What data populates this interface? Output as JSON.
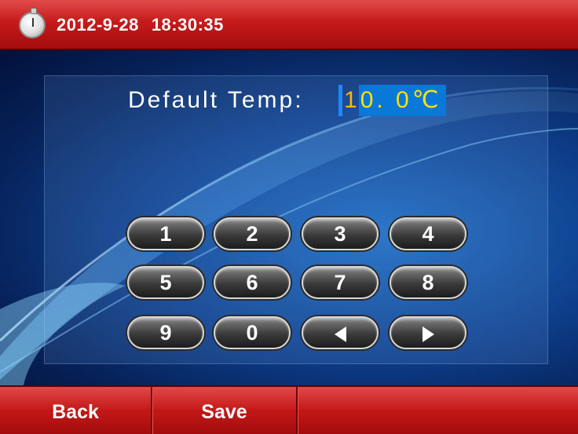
{
  "header": {
    "date": "2012-9-28",
    "time": "18:30:35",
    "icon": "stopwatch-icon"
  },
  "setting": {
    "label": "Default Temp:",
    "value_active_digit": "1",
    "value_rest": "0. 0℃"
  },
  "keypad": {
    "keys": [
      "1",
      "2",
      "3",
      "4",
      "5",
      "6",
      "7",
      "8",
      "9",
      "0"
    ],
    "left_icon": "left-arrow-icon",
    "right_icon": "right-arrow-icon"
  },
  "footer": {
    "back_label": "Back",
    "save_label": "Save"
  },
  "colors": {
    "header_red": "#c61a1a",
    "background_blue": "#0e3f8c",
    "value_highlight": "#0a78d8",
    "value_text": "#ffe200"
  }
}
